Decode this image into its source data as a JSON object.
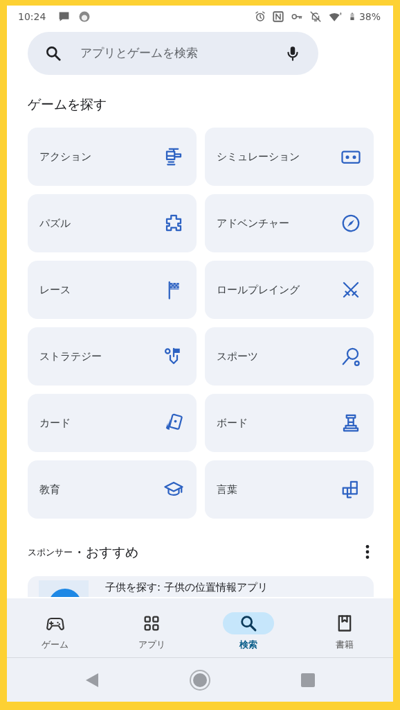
{
  "status_bar": {
    "time": "10:24",
    "battery": "38%"
  },
  "search": {
    "placeholder": "アプリとゲームを検索"
  },
  "section_title": "ゲームを探す",
  "categories": [
    {
      "label": "アクション"
    },
    {
      "label": "シミュレーション"
    },
    {
      "label": "パズル"
    },
    {
      "label": "アドベンチャー"
    },
    {
      "label": "レース"
    },
    {
      "label": "ロールプレイング"
    },
    {
      "label": "ストラテジー"
    },
    {
      "label": "スポーツ"
    },
    {
      "label": "カード"
    },
    {
      "label": "ボード"
    },
    {
      "label": "教育"
    },
    {
      "label": "言葉"
    }
  ],
  "sponsored": {
    "label": "スポンサー",
    "title": "・おすすめ",
    "app_name": "子供を探す: 子供の位置情報アプリ"
  },
  "bottom_nav": [
    {
      "label": "ゲーム",
      "selected": false
    },
    {
      "label": "アプリ",
      "selected": false
    },
    {
      "label": "検索",
      "selected": true
    },
    {
      "label": "書籍",
      "selected": false
    }
  ]
}
